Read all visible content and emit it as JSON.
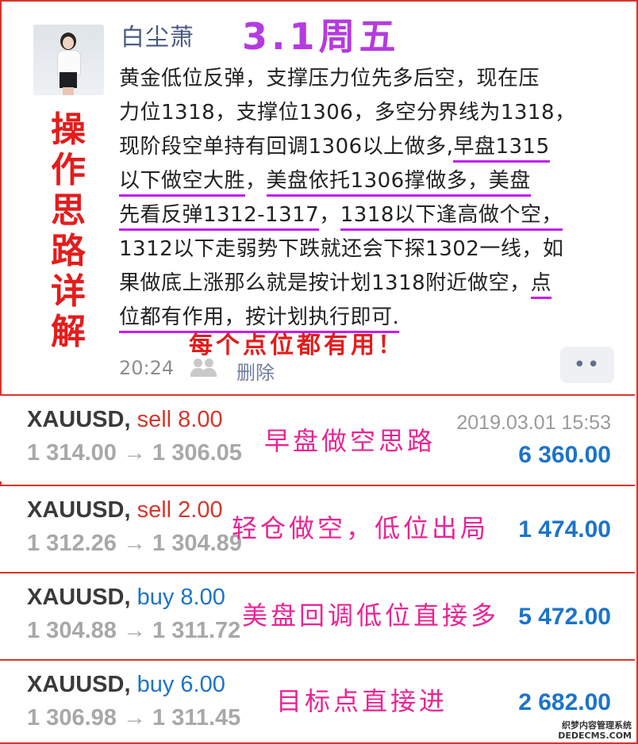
{
  "post": {
    "username": "白尘萧",
    "date_title": "3.1周五",
    "side_label": [
      "操",
      "作",
      "思",
      "路",
      "详",
      "解"
    ],
    "lines": [
      [
        {
          "t": "黄金低位反弹，支撑压力位先多后空，现在压",
          "u": false
        }
      ],
      [
        {
          "t": "力位1318，支撑位1306，多空分界线为1318，",
          "u": false
        }
      ],
      [
        {
          "t": "现阶段空单持有回调1306以上做多,",
          "u": false
        },
        {
          "t": "早盘1315",
          "u": true
        }
      ],
      [
        {
          "t": "以下做空大胜",
          "u": true
        },
        {
          "t": "，",
          "u": false
        },
        {
          "t": "美盘依托1306撑做多，美盘",
          "u": true
        }
      ],
      [
        {
          "t": "先看反弹1312-1317",
          "u": true
        },
        {
          "t": "，",
          "u": false
        },
        {
          "t": "1318以下逢高做个空，",
          "u": true
        }
      ],
      [
        {
          "t": "1312以下走弱势下跌就还会下探1302一线，如",
          "u": false
        }
      ],
      [
        {
          "t": "果做底上涨那么就是按计划1318附近做空，",
          "u": false
        },
        {
          "t": "点",
          "u": true
        }
      ],
      [
        {
          "t": "位都有作用，按计划执行即可.",
          "u": true
        }
      ]
    ],
    "note": "每个点位都有用！",
    "time": "20:24",
    "delete_label": "删除",
    "more_label": "••",
    "avatar_icon": "avatar-woman-icon",
    "people_icon": "people-icon"
  },
  "trades": [
    {
      "symbol": "XAUUSD,",
      "side": "sell",
      "volume": "8.00",
      "from": "1 314.00",
      "to": "1 306.05",
      "arrow": "→",
      "timestamp": "2019.03.01 15:53",
      "profit": "6 360.00",
      "annotation": "早盘做空思路"
    },
    {
      "symbol": "XAUUSD,",
      "side": "sell",
      "volume": "2.00",
      "from": "1 312.26",
      "to": "1 304.89",
      "arrow": "→",
      "timestamp": "",
      "profit": "1 474.00",
      "annotation": "轻仓做空，低位出局"
    },
    {
      "symbol": "XAUUSD,",
      "side": "buy",
      "volume": "8.00",
      "from": "1 304.88",
      "to": "1 311.72",
      "arrow": "→",
      "timestamp": "",
      "profit": "5 472.00",
      "annotation": "美盘回调低位直接多"
    },
    {
      "symbol": "XAUUSD,",
      "side": "buy",
      "volume": "6.00",
      "from": "1 306.98",
      "to": "1 311.45",
      "arrow": "→",
      "timestamp": "",
      "profit": "2 682.00",
      "annotation": "目标点直接进"
    }
  ],
  "watermark": {
    "line1": "织梦内容管理系统",
    "line2": "DEDECMS.COM"
  },
  "colors": {
    "frame": "#d9342b",
    "sell": "#d4372d",
    "buy": "#1c74c8",
    "annotation": "#ea2494",
    "underline": "#c21ff0",
    "date_title": "#b43be0"
  }
}
